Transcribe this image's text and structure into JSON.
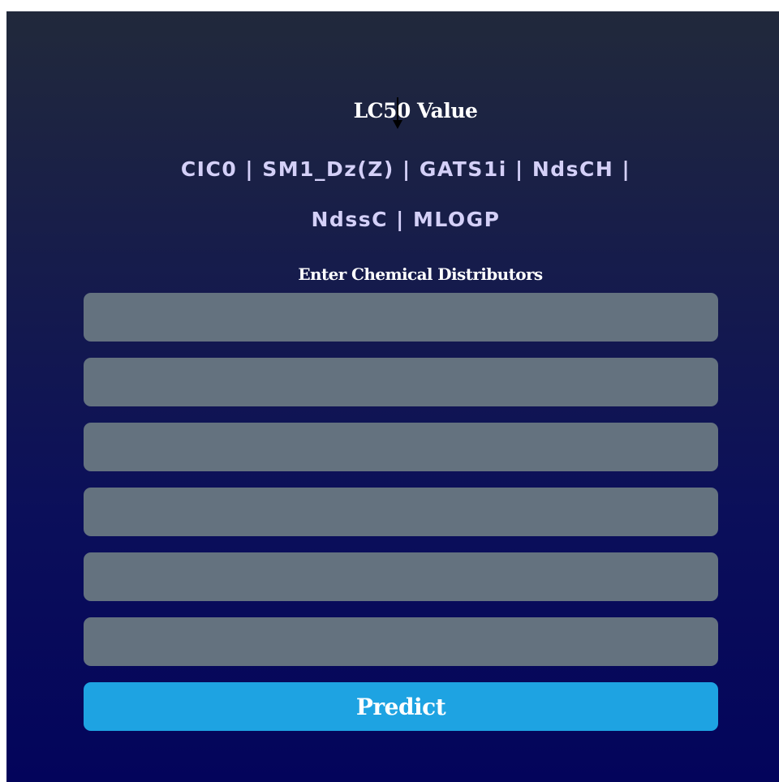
{
  "heading": {
    "title": "LC50 Value",
    "features_line1": "CIC0 | SM1_Dz(Z) | GATS1i | NdsCH |",
    "features_line2": "NdssC | MLOGP"
  },
  "form": {
    "label": "Enter Chemical Distributors",
    "fields": [
      {
        "value": "",
        "placeholder": ""
      },
      {
        "value": "",
        "placeholder": ""
      },
      {
        "value": "",
        "placeholder": ""
      },
      {
        "value": "",
        "placeholder": ""
      },
      {
        "value": "",
        "placeholder": ""
      },
      {
        "value": "",
        "placeholder": ""
      }
    ],
    "submit_label": "Predict"
  },
  "colors": {
    "gradient_top": "#21293b",
    "gradient_bottom": "#03045b",
    "field_bg": "#64727f",
    "button_bg": "#1ea3e2",
    "feature_text": "#d4d0f8"
  },
  "icons": {
    "cursor": "down-arrow-cursor-icon"
  }
}
